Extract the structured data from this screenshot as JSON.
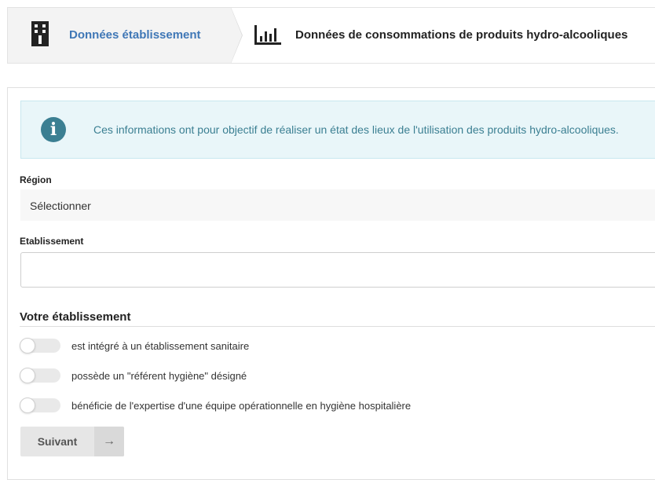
{
  "stepper": {
    "steps": [
      {
        "label": "Données établissement",
        "icon": "building-icon"
      },
      {
        "label": "Données de consommations de produits hydro-alcooliques",
        "icon": "bar-chart-icon"
      }
    ]
  },
  "info": {
    "icon": "info-icon",
    "text": "Ces informations ont pour objectif de réaliser un état des lieux de l'utilisation des produits hydro-alcooliques."
  },
  "form": {
    "region_label": "Région",
    "region_value": "Sélectionner",
    "etablissement_label": "Etablissement",
    "etablissement_value": ""
  },
  "section": {
    "title": "Votre établissement",
    "toggles": [
      {
        "label": "est intégré à un établissement sanitaire",
        "checked": false
      },
      {
        "label": "possède un \"référent hygiène\" désigné",
        "checked": false
      },
      {
        "label": "bénéficie de l'expertise d'une équipe opérationnelle en hygiène hospitalière",
        "checked": false
      }
    ]
  },
  "button": {
    "label": "Suivant",
    "icon": "arrow-right-icon"
  },
  "colors": {
    "accent": "#3f77b6",
    "info_text": "#3b7f92",
    "info_bg": "#e9f6f9"
  }
}
